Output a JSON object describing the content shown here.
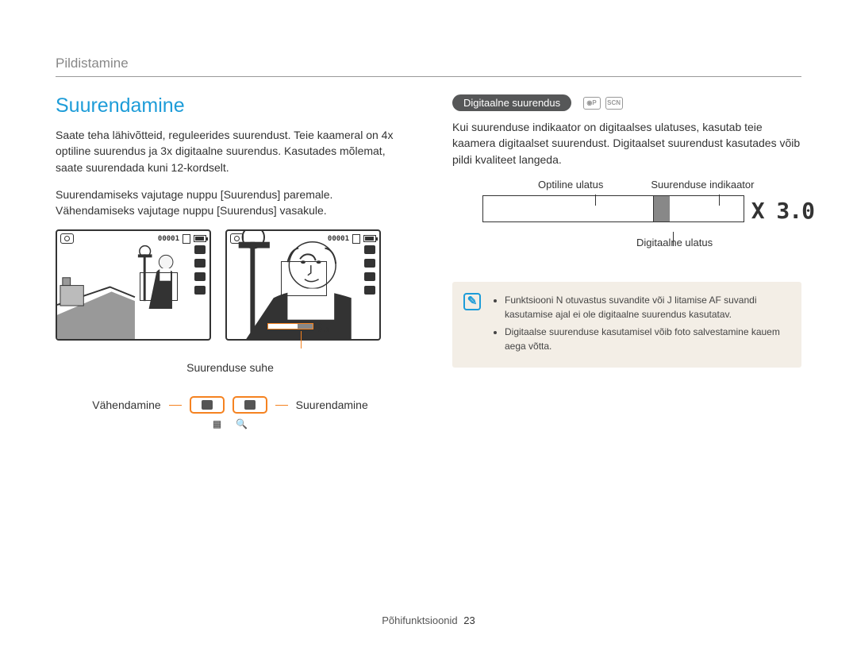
{
  "header": {
    "section": "Pildistamine"
  },
  "left": {
    "title": "Suurendamine",
    "para1": "Saate teha lähivõtteid, reguleerides suurendust. Teie kaameral on 4x optiline suurendus ja 3x digitaalne suurendus. Kasutades mõlemat, saate suurendada kuni 12-kordselt.",
    "para2": "Suurendamiseks vajutage nuppu [Suurendus] paremale. Vähendamiseks vajutage nuppu [Suurendus] vasakule.",
    "counter": "00001",
    "zoom_ratio_text": "X 3.0",
    "ratio_label": "Suurenduse suhe",
    "zoom_out_label": "Vähendamine",
    "zoom_in_label": "Suurendamine"
  },
  "right": {
    "pill": "Digitaalne suurendus",
    "para": "Kui suurenduse indikaator on digitaalses ulatuses, kasutab teie kaamera digitaalset suurendust. Digitaalset suurendust kasutades võib pildi kvaliteet langeda.",
    "label_optical": "Optiline ulatus",
    "label_indicator": "Suurenduse indikaator",
    "label_digital": "Digitaalne ulatus",
    "x_label": "X 3.0",
    "notes": [
      "Funktsiooni N otuvastus suvandite või J litamise AF suvandi kasutamise ajal ei ole digitaalne suurendus kasutatav.",
      "Digitaalse suurenduse kasutamisel võib foto salvestamine kauem aega võtta."
    ]
  },
  "footer": {
    "label": "Põhifunktsioonid",
    "page": "23"
  }
}
